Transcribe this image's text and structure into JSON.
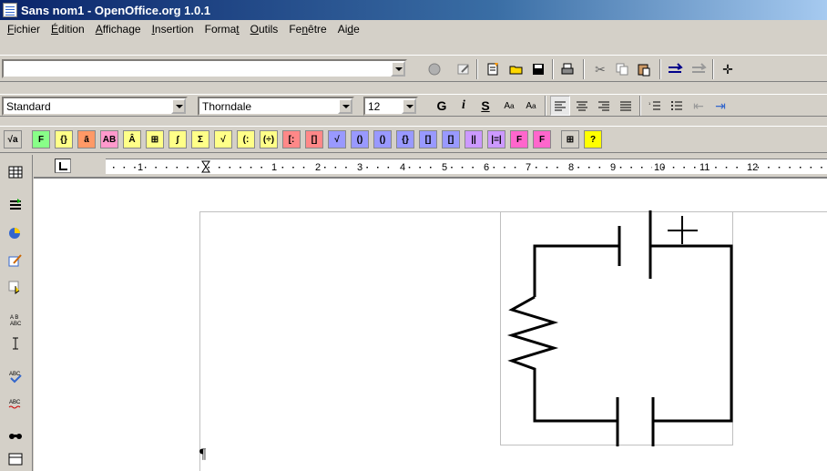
{
  "window": {
    "title": "Sans nom1 - OpenOffice.org 1.0.1"
  },
  "menu": [
    {
      "pre": "",
      "u": "F",
      "post": "ichier"
    },
    {
      "pre": "",
      "u": "É",
      "post": "dition"
    },
    {
      "pre": "",
      "u": "A",
      "post": "ffichage"
    },
    {
      "pre": "",
      "u": "I",
      "post": "nsertion"
    },
    {
      "pre": "Forma",
      "u": "t",
      "post": ""
    },
    {
      "pre": "",
      "u": "O",
      "post": "utils"
    },
    {
      "pre": "Fe",
      "u": "n",
      "post": "être"
    },
    {
      "pre": "Ai",
      "u": "d",
      "post": "e"
    }
  ],
  "toolbar1": {
    "url_value": ""
  },
  "toolbar2": {
    "style": "Standard",
    "font": "Thorndale",
    "size": "12",
    "bold": "G",
    "italic": "i",
    "underline": "S"
  },
  "math_toolbar": {
    "buttons": [
      "√a",
      "F",
      "{}",
      "ā",
      "AB",
      "Â",
      "⊞",
      "∫",
      "Σ",
      "√",
      "(:",
      "(÷)",
      "[:",
      "[]",
      "√",
      "()",
      "()",
      "{}",
      "[]",
      "[]",
      "||",
      "|=|",
      "F",
      "F",
      "⊞",
      "?"
    ]
  },
  "ruler": {
    "labels": [
      "1",
      "1",
      "2",
      "3",
      "4",
      "5",
      "6",
      "7",
      "8",
      "9",
      "10",
      "11",
      "12"
    ]
  },
  "document": {
    "paragraph_mark": "¶",
    "plus_sign": "+"
  },
  "colors": {
    "title_start": "#0a246a",
    "title_end": "#a6caf0",
    "face": "#d4d0c8"
  }
}
